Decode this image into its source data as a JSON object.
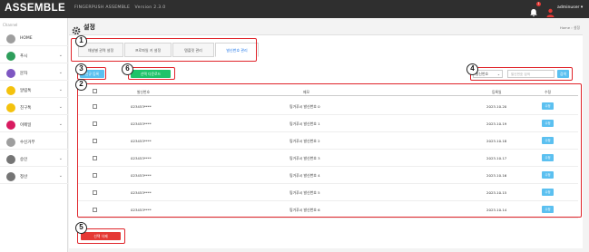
{
  "topbar": {
    "logo": "ASSEMBLE",
    "brand": "FINGERPUSH ASSEMBLE",
    "version": "Version 2.3.0",
    "notification_count": "1",
    "username": "adminuser"
  },
  "sidebar": {
    "channel_label": "Channel",
    "items": [
      {
        "label": "HOME",
        "icon": "home-icon",
        "color": "#9e9e9e",
        "chevron": false
      },
      {
        "label": "푸시",
        "icon": "push-icon",
        "color": "#2e9e5b",
        "chevron": true
      },
      {
        "label": "문자",
        "icon": "sms-icon",
        "color": "#7e57c2",
        "chevron": true
      },
      {
        "label": "알림톡",
        "icon": "alimtalk-icon",
        "color": "#f4c20d",
        "chevron": true
      },
      {
        "label": "친구톡",
        "icon": "friendtalk-icon",
        "color": "#f4c20d",
        "chevron": true
      },
      {
        "label": "이메일",
        "icon": "email-icon",
        "color": "#d81b60",
        "chevron": true
      },
      {
        "label": "수신거부",
        "icon": "block-icon",
        "color": "#9e9e9e",
        "chevron": false
      },
      {
        "label": "승인",
        "icon": "approve-icon",
        "color": "#757575",
        "chevron": true
      },
      {
        "label": "정산",
        "icon": "settle-icon",
        "color": "#757575",
        "chevron": true
      }
    ]
  },
  "page": {
    "title": "설정",
    "breadcrumb": "Home  ›  설정"
  },
  "tabs": [
    {
      "label": "채널별 권역 설정"
    },
    {
      "label": "프로파일 키 설정"
    },
    {
      "label": "템플릿 관리"
    },
    {
      "label": "발신번호 관리",
      "active": true
    }
  ],
  "actions": {
    "register_label": "신규 등록",
    "download_label": "선택 다운로드",
    "delete_label": "선택 삭제"
  },
  "search": {
    "select_value": "발신번호",
    "placeholder": "발신번호 검색",
    "button_label": "검색"
  },
  "table": {
    "headers": [
      "발신번호",
      "메모",
      "등록일",
      "수정"
    ],
    "rows": [
      {
        "number": "023453****",
        "memo": "핑거푸시 발신번호 0",
        "date": "2023.10.20",
        "edit": "수정"
      },
      {
        "number": "023453****",
        "memo": "핑거푸시 발신번호 1",
        "date": "2023.10.19",
        "edit": "수정"
      },
      {
        "number": "023453****",
        "memo": "핑거푸시 발신번호 2",
        "date": "2023.10.18",
        "edit": "수정"
      },
      {
        "number": "023453****",
        "memo": "핑거푸시 발신번호 3",
        "date": "2023.10.17",
        "edit": "수정"
      },
      {
        "number": "023453****",
        "memo": "핑거푸시 발신번호 4",
        "date": "2023.10.16",
        "edit": "수정"
      },
      {
        "number": "023453****",
        "memo": "핑거푸시 발신번호 5",
        "date": "2023.10.15",
        "edit": "수정"
      },
      {
        "number": "023453****",
        "memo": "핑거푸시 발신번호 6",
        "date": "2023.10.14",
        "edit": "수정"
      }
    ]
  },
  "annotations": [
    "1",
    "2",
    "3",
    "4",
    "5",
    "6"
  ],
  "colors": {
    "accent_blue": "#5bc0f0",
    "download_green": "#1fc36a",
    "delete_red": "#e53935",
    "annotation_red": "#e0242a"
  }
}
